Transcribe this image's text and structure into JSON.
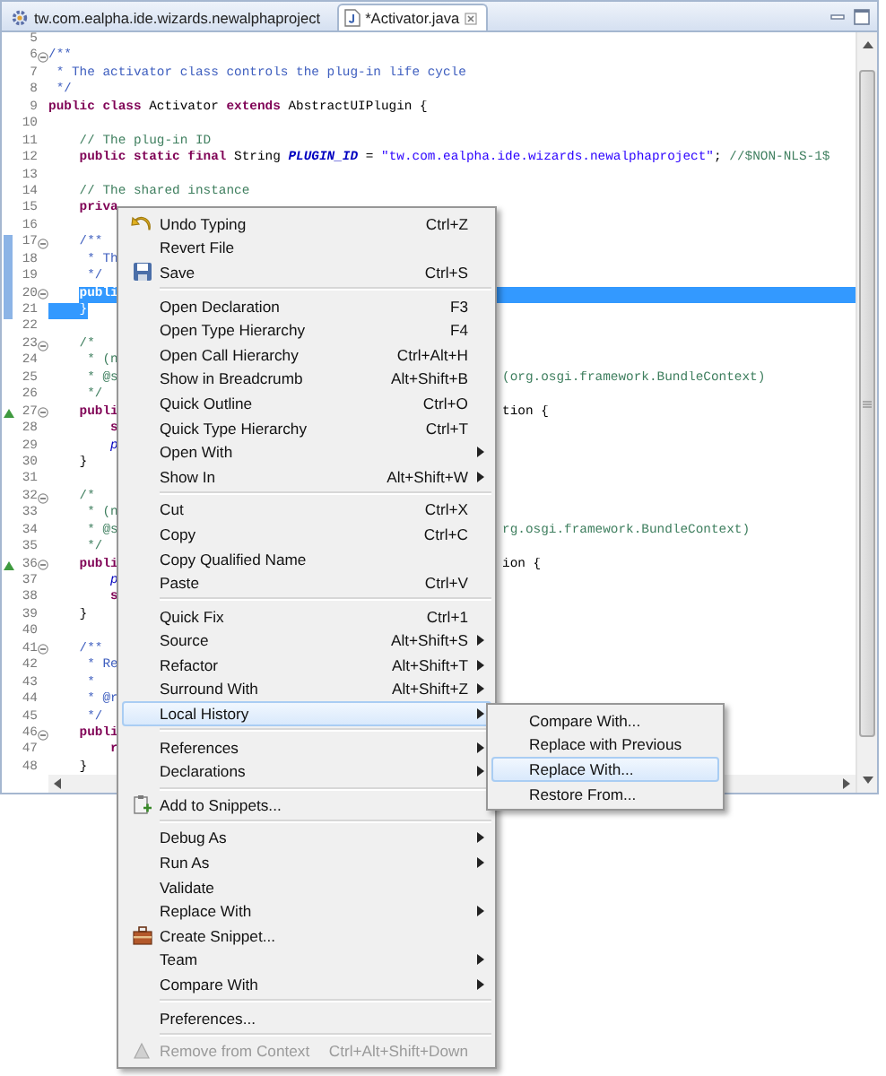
{
  "editor": {
    "tabs": [
      {
        "label": "tw.com.ealpha.ide.wizards.newalphaproject",
        "selected": false,
        "closable": false
      },
      {
        "label": "*Activator.java",
        "selected": true,
        "closable": true
      }
    ],
    "lines": [
      {
        "number": "5"
      },
      {
        "number": "6",
        "expanded": true,
        "code": [
          {
            "text": "/**",
            "kind": "doc"
          }
        ]
      },
      {
        "number": "7",
        "code": [
          {
            "text": " * The activator class controls the plug-in life cycle",
            "kind": "doc"
          }
        ]
      },
      {
        "number": "8",
        "code": [
          {
            "text": " */",
            "kind": "doc"
          }
        ]
      },
      {
        "number": "9",
        "code": [
          {
            "text": "public class",
            "kind": "keyword"
          },
          {
            "text": " Activator ",
            "kind": "plain"
          },
          {
            "text": "extends",
            "kind": "keyword"
          },
          {
            "text": " AbstractUIPlugin {",
            "kind": "plain"
          }
        ]
      },
      {
        "number": "10"
      },
      {
        "number": "11",
        "code": [
          {
            "text": "    // The plug-in ID",
            "kind": "comment"
          }
        ]
      },
      {
        "number": "12",
        "code": [
          {
            "text": "    public static final",
            "kind": "keyword"
          },
          {
            "text": " String ",
            "kind": "plain"
          },
          {
            "text": "PLUGIN_ID",
            "kind": "constant"
          },
          {
            "text": " = ",
            "kind": "plain"
          },
          {
            "text": "\"tw.com.ealpha.ide.wizards.newalphaproject\"",
            "kind": "string"
          },
          {
            "text": "; ",
            "kind": "plain"
          },
          {
            "text": "//$NON-NLS-1$",
            "kind": "comment"
          }
        ]
      },
      {
        "number": "13"
      },
      {
        "number": "14",
        "code": [
          {
            "text": "    // The shared instance",
            "kind": "comment"
          }
        ]
      },
      {
        "number": "15",
        "code": [
          {
            "text": "    priva",
            "kind": "keyword"
          }
        ]
      },
      {
        "number": "16"
      },
      {
        "number": "17",
        "expanded": true,
        "changed": true,
        "code": [
          {
            "text": "    /**",
            "kind": "doc"
          }
        ]
      },
      {
        "number": "18",
        "changed": true,
        "code": [
          {
            "text": "     * Th",
            "kind": "doc"
          }
        ]
      },
      {
        "number": "19",
        "changed": true,
        "code": [
          {
            "text": "     */",
            "kind": "doc"
          }
        ]
      },
      {
        "number": "20",
        "expanded": true,
        "changed": true,
        "selected": true,
        "code": [
          {
            "text": "    publi",
            "kind": "keyword"
          }
        ]
      },
      {
        "number": "21",
        "changed": true,
        "selected": true,
        "code": [
          {
            "text": "    }",
            "kind": "plain"
          }
        ]
      },
      {
        "number": "22"
      },
      {
        "number": "23",
        "expanded": true,
        "code": [
          {
            "text": "    /*",
            "kind": "comment"
          }
        ]
      },
      {
        "number": "24",
        "code": [
          {
            "text": "     * (n",
            "kind": "comment"
          }
        ]
      },
      {
        "number": "25",
        "code": [
          {
            "text": "     * @s",
            "kind": "comment"
          }
        ],
        "right": [
          {
            "text": "(org.osgi.framework.BundleContext)",
            "kind": "comment"
          }
        ]
      },
      {
        "number": "26",
        "code": [
          {
            "text": "     */",
            "kind": "comment"
          }
        ]
      },
      {
        "number": "27",
        "expanded": true,
        "override": true,
        "code": [
          {
            "text": "    publi",
            "kind": "keyword"
          }
        ],
        "right": [
          {
            "text": "tion {",
            "kind": "plain"
          }
        ]
      },
      {
        "number": "28",
        "code": [
          {
            "text": "        s",
            "kind": "keyword"
          }
        ]
      },
      {
        "number": "29",
        "code": [
          {
            "text": "        p",
            "kind": "field"
          }
        ]
      },
      {
        "number": "30",
        "code": [
          {
            "text": "    }",
            "kind": "plain"
          }
        ]
      },
      {
        "number": "31"
      },
      {
        "number": "32",
        "expanded": true,
        "code": [
          {
            "text": "    /*",
            "kind": "comment"
          }
        ]
      },
      {
        "number": "33",
        "code": [
          {
            "text": "     * (n",
            "kind": "comment"
          }
        ]
      },
      {
        "number": "34",
        "code": [
          {
            "text": "     * @s",
            "kind": "comment"
          }
        ],
        "right": [
          {
            "text": "rg.osgi.framework.BundleContext)",
            "kind": "comment"
          }
        ]
      },
      {
        "number": "35",
        "code": [
          {
            "text": "     */",
            "kind": "comment"
          }
        ]
      },
      {
        "number": "36",
        "expanded": true,
        "override": true,
        "code": [
          {
            "text": "    publi",
            "kind": "keyword"
          }
        ],
        "right": [
          {
            "text": "ion {",
            "kind": "plain"
          }
        ]
      },
      {
        "number": "37",
        "code": [
          {
            "text": "        p",
            "kind": "field"
          }
        ]
      },
      {
        "number": "38",
        "code": [
          {
            "text": "        s",
            "kind": "keyword"
          }
        ]
      },
      {
        "number": "39",
        "code": [
          {
            "text": "    }",
            "kind": "plain"
          }
        ]
      },
      {
        "number": "40"
      },
      {
        "number": "41",
        "expanded": true,
        "code": [
          {
            "text": "    /**",
            "kind": "doc"
          }
        ]
      },
      {
        "number": "42",
        "code": [
          {
            "text": "     * Re",
            "kind": "doc"
          }
        ]
      },
      {
        "number": "43",
        "code": [
          {
            "text": "     *",
            "kind": "doc"
          }
        ]
      },
      {
        "number": "44",
        "code": [
          {
            "text": "     * @r",
            "kind": "doc"
          }
        ]
      },
      {
        "number": "45",
        "code": [
          {
            "text": "     */",
            "kind": "doc"
          }
        ]
      },
      {
        "number": "46",
        "expanded": true,
        "code": [
          {
            "text": "    publi",
            "kind": "keyword"
          }
        ]
      },
      {
        "number": "47",
        "code": [
          {
            "text": "        r",
            "kind": "keyword"
          }
        ]
      },
      {
        "number": "48",
        "code": [
          {
            "text": "    }",
            "kind": "plain"
          }
        ]
      }
    ]
  },
  "context_menu": {
    "items": [
      {
        "kind": "item",
        "label": "Undo Typing",
        "shortcut": "Ctrl+Z",
        "submenu": false,
        "selected": false,
        "disabled": false
      },
      {
        "kind": "item",
        "label": "Revert File",
        "submenu": false,
        "selected": false,
        "disabled": false
      },
      {
        "kind": "item",
        "label": "Save",
        "shortcut": "Ctrl+S",
        "submenu": false,
        "selected": false,
        "disabled": false
      },
      {
        "kind": "separator"
      },
      {
        "kind": "item",
        "label": "Open Declaration",
        "shortcut": "F3",
        "submenu": false,
        "selected": false,
        "disabled": false
      },
      {
        "kind": "item",
        "label": "Open Type Hierarchy",
        "shortcut": "F4",
        "submenu": false,
        "selected": false,
        "disabled": false
      },
      {
        "kind": "item",
        "label": "Open Call Hierarchy",
        "shortcut": "Ctrl+Alt+H",
        "submenu": false,
        "selected": false,
        "disabled": false
      },
      {
        "kind": "item",
        "label": "Show in Breadcrumb",
        "shortcut": "Alt+Shift+B",
        "submenu": false,
        "selected": false,
        "disabled": false
      },
      {
        "kind": "item",
        "label": "Quick Outline",
        "shortcut": "Ctrl+O",
        "submenu": false,
        "selected": false,
        "disabled": false
      },
      {
        "kind": "item",
        "label": "Quick Type Hierarchy",
        "shortcut": "Ctrl+T",
        "submenu": false,
        "selected": false,
        "disabled": false
      },
      {
        "kind": "item",
        "label": "Open With",
        "submenu": true,
        "selected": false,
        "disabled": false
      },
      {
        "kind": "item",
        "label": "Show In",
        "shortcut": "Alt+Shift+W",
        "submenu": true,
        "selected": false,
        "disabled": false
      },
      {
        "kind": "separator"
      },
      {
        "kind": "item",
        "label": "Cut",
        "shortcut": "Ctrl+X",
        "submenu": false,
        "selected": false,
        "disabled": false
      },
      {
        "kind": "item",
        "label": "Copy",
        "shortcut": "Ctrl+C",
        "submenu": false,
        "selected": false,
        "disabled": false
      },
      {
        "kind": "item",
        "label": "Copy Qualified Name",
        "submenu": false,
        "selected": false,
        "disabled": false
      },
      {
        "kind": "item",
        "label": "Paste",
        "shortcut": "Ctrl+V",
        "submenu": false,
        "selected": false,
        "disabled": false
      },
      {
        "kind": "separator"
      },
      {
        "kind": "item",
        "label": "Quick Fix",
        "shortcut": "Ctrl+1",
        "submenu": false,
        "selected": false,
        "disabled": false
      },
      {
        "kind": "item",
        "label": "Source",
        "shortcut": "Alt+Shift+S",
        "submenu": true,
        "selected": false,
        "disabled": false
      },
      {
        "kind": "item",
        "label": "Refactor",
        "shortcut": "Alt+Shift+T",
        "submenu": true,
        "selected": false,
        "disabled": false
      },
      {
        "kind": "item",
        "label": "Surround With",
        "shortcut": "Alt+Shift+Z",
        "submenu": true,
        "selected": false,
        "disabled": false
      },
      {
        "kind": "item",
        "label": "Local History",
        "submenu": true,
        "selected": true,
        "disabled": false
      },
      {
        "kind": "separator"
      },
      {
        "kind": "item",
        "label": "References",
        "submenu": true,
        "selected": false,
        "disabled": false
      },
      {
        "kind": "item",
        "label": "Declarations",
        "submenu": true,
        "selected": false,
        "disabled": false
      },
      {
        "kind": "separator"
      },
      {
        "kind": "item",
        "label": "Add to Snippets...",
        "submenu": false,
        "selected": false,
        "disabled": false
      },
      {
        "kind": "separator"
      },
      {
        "kind": "item",
        "label": "Debug As",
        "submenu": true,
        "selected": false,
        "disabled": false
      },
      {
        "kind": "item",
        "label": "Run As",
        "submenu": true,
        "selected": false,
        "disabled": false
      },
      {
        "kind": "item",
        "label": "Validate",
        "submenu": false,
        "selected": false,
        "disabled": false
      },
      {
        "kind": "item",
        "label": "Replace With",
        "submenu": true,
        "selected": false,
        "disabled": false
      },
      {
        "kind": "item",
        "label": "Create Snippet...",
        "submenu": false,
        "selected": false,
        "disabled": false
      },
      {
        "kind": "item",
        "label": "Team",
        "submenu": true,
        "selected": false,
        "disabled": false
      },
      {
        "kind": "item",
        "label": "Compare With",
        "submenu": true,
        "selected": false,
        "disabled": false
      },
      {
        "kind": "separator"
      },
      {
        "kind": "item",
        "label": "Preferences...",
        "submenu": false,
        "selected": false,
        "disabled": false
      },
      {
        "kind": "separator"
      },
      {
        "kind": "item",
        "label": "Remove from Context",
        "shortcut": "Ctrl+Alt+Shift+Down",
        "submenu": false,
        "selected": false,
        "disabled": true
      }
    ]
  },
  "submenu": {
    "items": [
      {
        "label": "Compare With...",
        "selected": false
      },
      {
        "label": "Replace with Previous",
        "selected": false
      },
      {
        "label": "Replace With...",
        "selected": true
      },
      {
        "label": "Restore From...",
        "selected": false
      }
    ]
  }
}
